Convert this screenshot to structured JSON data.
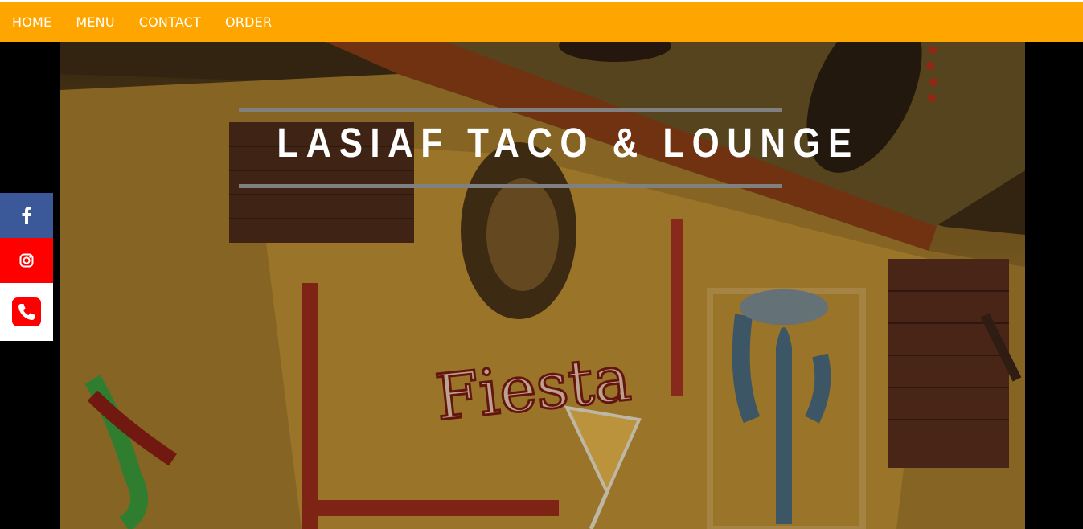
{
  "nav": {
    "items": [
      {
        "label": "HOME"
      },
      {
        "label": "MENU"
      },
      {
        "label": "CONTACT"
      },
      {
        "label": "ORDER"
      }
    ]
  },
  "hero": {
    "title": "LASIAF TACO & LOUNGE",
    "mural_text": "Fiesta"
  },
  "social": {
    "facebook_icon": "facebook-icon",
    "instagram_icon": "instagram-icon",
    "phone_icon": "phone-icon"
  },
  "colors": {
    "nav_bg": "#ffa500",
    "facebook": "#3b5998",
    "instagram": "#ff0000",
    "phone": "#ff0000"
  }
}
